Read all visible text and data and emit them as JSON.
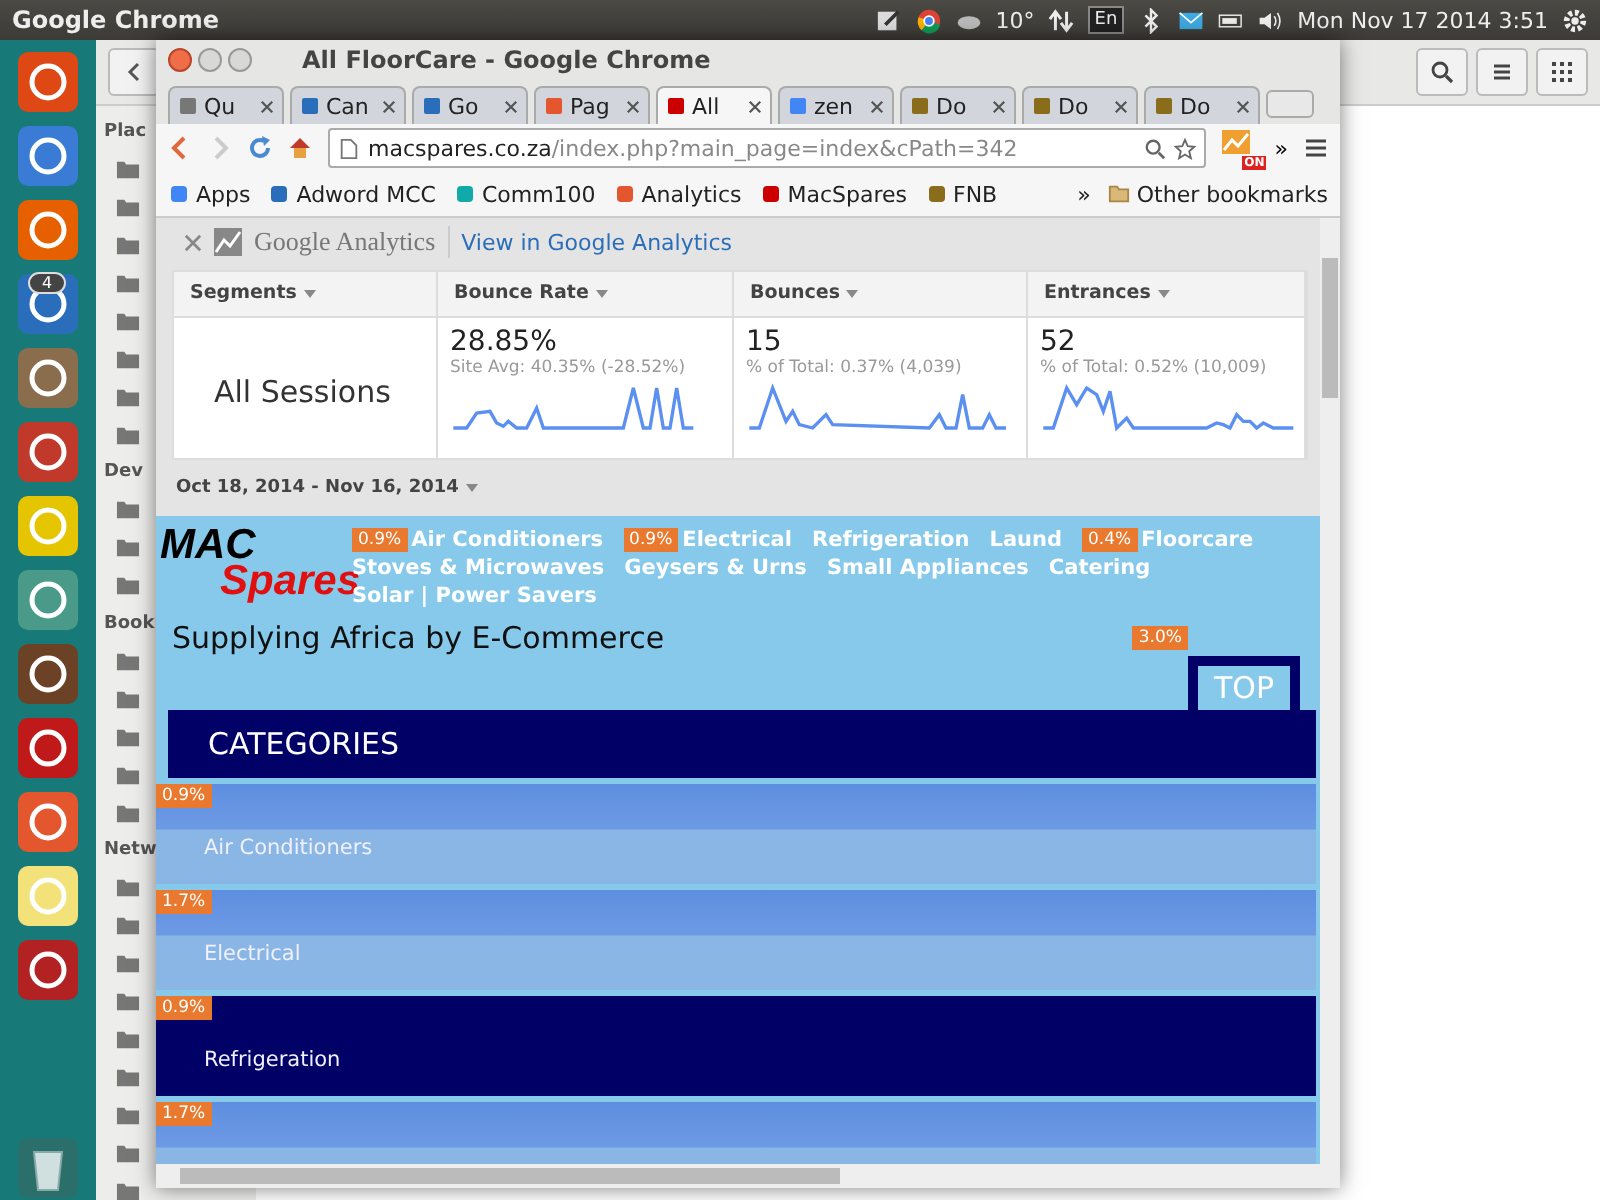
{
  "top_panel": {
    "app_name": "Google Chrome",
    "weather": "10°",
    "keyboard": "En",
    "clock": "Mon Nov 17 2014 3:51"
  },
  "launcher": {
    "badge": "4"
  },
  "file_manager": {
    "sidebar_sections": [
      "Plac",
      "Dev",
      "Book",
      "Netw"
    ]
  },
  "browser": {
    "title": "All FloorCare - Google Chrome",
    "tabs": [
      {
        "label": "Qu",
        "selected": false
      },
      {
        "label": "Can",
        "selected": false
      },
      {
        "label": "Go",
        "selected": false
      },
      {
        "label": "Pag",
        "selected": false
      },
      {
        "label": "All",
        "selected": true
      },
      {
        "label": "zen",
        "selected": false
      },
      {
        "label": "Do",
        "selected": false
      },
      {
        "label": "Do",
        "selected": false
      },
      {
        "label": "Do",
        "selected": false
      }
    ],
    "url": {
      "domain": "macspares.co.za",
      "path": "/index.php?main_page=index&cPath=342"
    },
    "extension_badge": "ON",
    "toolbar_more": "»",
    "bookmarks": [
      "Apps",
      "Adword MCC",
      "Comm100",
      "Analytics",
      "MacSpares",
      "FNB"
    ],
    "bookmarks_more": "»",
    "other_bookmarks": "Other bookmarks"
  },
  "analytics": {
    "logo": "Google Analytics",
    "link": "View in Google Analytics",
    "columns": [
      "Segments",
      "Bounce Rate",
      "Bounces",
      "Entrances"
    ],
    "segment": "All Sessions",
    "metrics": [
      {
        "value": "28.85%",
        "detail": "Site Avg: 40.35% (-28.52%)"
      },
      {
        "value": "15",
        "detail": "% of Total: 0.37% (4,039)"
      },
      {
        "value": "52",
        "detail": "% of Total: 0.52% (10,009)"
      }
    ],
    "date_range": "Oct 18, 2014 - Nov 16, 2014"
  },
  "site": {
    "logo": {
      "first": "MAC",
      "second": "Spares"
    },
    "nav": [
      {
        "label": "Air Conditioners",
        "badge": "0.9%"
      },
      {
        "label": "Electrical",
        "badge": "0.9%"
      },
      {
        "label": "Refrigeration"
      },
      {
        "label": "Laund"
      },
      {
        "label": "Floorcare",
        "badge": "0.4%"
      },
      {
        "label": "Stoves & Microwaves"
      },
      {
        "label": "Geysers & Urns"
      },
      {
        "label": "Small Appliances"
      },
      {
        "label": "Catering"
      },
      {
        "label": "Solar | Power Savers"
      }
    ],
    "tagline": "Supplying Africa by E-Commerce",
    "tagline_badge": "3.0%",
    "top_button": "TOP",
    "categories_title": "CATEGORIES",
    "categories": [
      {
        "label": "Air Conditioners",
        "badge": "0.9%",
        "selected": false
      },
      {
        "label": "Electrical",
        "badge": "1.7%",
        "selected": false
      },
      {
        "label": "Refrigeration",
        "badge": "0.9%",
        "selected": true
      },
      {
        "badge": "1.7%",
        "selected": false
      }
    ]
  }
}
